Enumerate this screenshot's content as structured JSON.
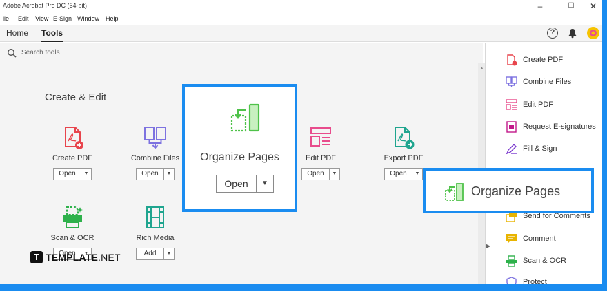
{
  "window": {
    "title": "Adobe Acrobat Pro DC (64-bit)",
    "controls": [
      "–",
      "☐",
      "✕"
    ]
  },
  "menu": [
    "ile",
    "Edit",
    "View",
    "E-Sign",
    "Window",
    "Help"
  ],
  "tabs": [
    "Home",
    "Tools"
  ],
  "header_icons": [
    "help-icon",
    "bell-icon",
    "avatar-icon"
  ],
  "search": {
    "placeholder": "Search tools"
  },
  "section_title": "Create & Edit",
  "tools": [
    {
      "label": "Create PDF",
      "button": "Open",
      "icon": "create-pdf-icon"
    },
    {
      "label": "Combine Files",
      "button": "Open",
      "icon": "combine-files-icon"
    },
    {
      "label": "Edit PDF",
      "button": "Open",
      "icon": "edit-pdf-icon"
    },
    {
      "label": "Export PDF",
      "button": "Open",
      "icon": "export-pdf-icon"
    },
    {
      "label": "Scan & OCR",
      "button": "Open",
      "icon": "scan-ocr-icon"
    },
    {
      "label": "Rich Media",
      "button": "Add",
      "icon": "rich-media-icon"
    }
  ],
  "highlight": {
    "label": "Organize Pages",
    "button": "Open",
    "icon": "organize-pages-icon"
  },
  "callout": {
    "label": "Organize Pages",
    "icon": "organize-pages-icon"
  },
  "right_panel": [
    {
      "label": "Create PDF",
      "icon": "create-pdf-icon"
    },
    {
      "label": "Combine Files",
      "icon": "combine-files-icon"
    },
    {
      "label": "Edit PDF",
      "icon": "edit-pdf-icon"
    },
    {
      "label": "Request E-signatures",
      "icon": "request-esign-icon"
    },
    {
      "label": "Fill & Sign",
      "icon": "fill-sign-icon"
    },
    {
      "label": "Send for Comments",
      "icon": "send-comments-icon"
    },
    {
      "label": "Comment",
      "icon": "comment-icon"
    },
    {
      "label": "Scan & OCR",
      "icon": "scan-ocr-icon"
    },
    {
      "label": "Protect",
      "icon": "protect-icon"
    }
  ],
  "watermark": {
    "logo": "T",
    "brand": "TEMPLATE",
    "suffix": ".NET"
  },
  "colors": {
    "accent": "#1a8cf0",
    "create": "#e8444c",
    "combine": "#7d72e0",
    "edit": "#e84c8c",
    "export": "#1fa58f",
    "scan": "#2eb14b",
    "organize": "#4fc24a"
  }
}
